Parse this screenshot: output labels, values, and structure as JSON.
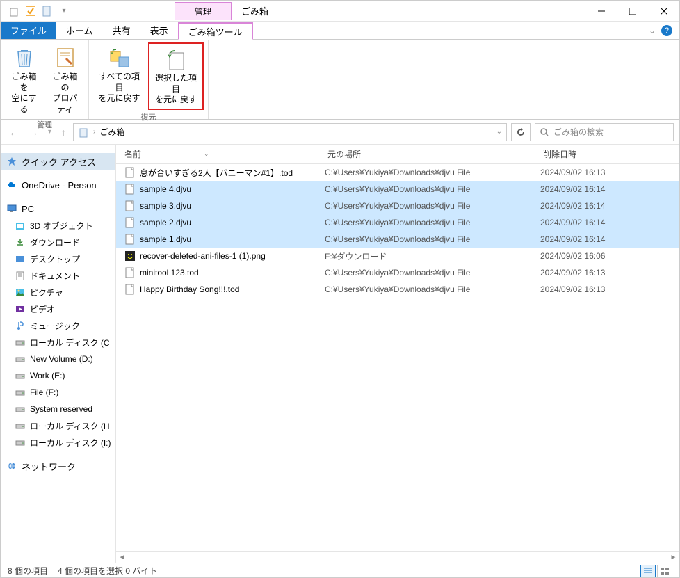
{
  "titlebar": {
    "manage_tab": "管理",
    "title": "ごみ箱"
  },
  "menubar": {
    "file": "ファイル",
    "home": "ホーム",
    "share": "共有",
    "view": "表示",
    "tools": "ごみ箱ツール"
  },
  "ribbon": {
    "group_manage": "管理",
    "group_restore": "復元",
    "empty_label": "ごみ箱を\n空にする",
    "properties_label": "ごみ箱の\nプロパティ",
    "restore_all_label": "すべての項目\nを元に戻す",
    "restore_sel_label": "選択した項目\nを元に戻す"
  },
  "nav": {
    "location": "ごみ箱",
    "search_placeholder": "ごみ箱の検索"
  },
  "sidebar": {
    "quick_access": "クイック アクセス",
    "onedrive": "OneDrive - Person",
    "pc": "PC",
    "items": [
      "3D オブジェクト",
      "ダウンロード",
      "デスクトップ",
      "ドキュメント",
      "ピクチャ",
      "ビデオ",
      "ミュージック",
      "ローカル ディスク (C",
      "New Volume (D:)",
      "Work (E:)",
      "File (F:)",
      "System reserved",
      "ローカル ディスク (H",
      "ローカル ディスク (I:)"
    ],
    "network": "ネットワーク"
  },
  "columns": {
    "name": "名前",
    "location": "元の場所",
    "deleted": "削除日時"
  },
  "files": [
    {
      "name": "息が合いすぎる2人【バニーマン#1】.tod",
      "loc": "C:¥Users¥Yukiya¥Downloads¥djvu File",
      "date": "2024/09/02 16:13",
      "selected": false,
      "icon": "file"
    },
    {
      "name": "sample 4.djvu",
      "loc": "C:¥Users¥Yukiya¥Downloads¥djvu File",
      "date": "2024/09/02 16:14",
      "selected": true,
      "icon": "file"
    },
    {
      "name": "sample 3.djvu",
      "loc": "C:¥Users¥Yukiya¥Downloads¥djvu File",
      "date": "2024/09/02 16:14",
      "selected": true,
      "icon": "file"
    },
    {
      "name": "sample 2.djvu",
      "loc": "C:¥Users¥Yukiya¥Downloads¥djvu File",
      "date": "2024/09/02 16:14",
      "selected": true,
      "icon": "file"
    },
    {
      "name": "sample 1.djvu",
      "loc": "C:¥Users¥Yukiya¥Downloads¥djvu File",
      "date": "2024/09/02 16:14",
      "selected": true,
      "icon": "file"
    },
    {
      "name": "recover-deleted-ani-files-1 (1).png",
      "loc": "F:¥ダウンロード",
      "date": "2024/09/02 16:06",
      "selected": false,
      "icon": "img"
    },
    {
      "name": "minitool 123.tod",
      "loc": "C:¥Users¥Yukiya¥Downloads¥djvu File",
      "date": "2024/09/02 16:13",
      "selected": false,
      "icon": "file"
    },
    {
      "name": "Happy Birthday Song!!!.tod",
      "loc": "C:¥Users¥Yukiya¥Downloads¥djvu File",
      "date": "2024/09/02 16:13",
      "selected": false,
      "icon": "file"
    }
  ],
  "status": {
    "items_count": "8 個の項目",
    "selected_count": "4 個の項目を選択 0 バイト"
  }
}
